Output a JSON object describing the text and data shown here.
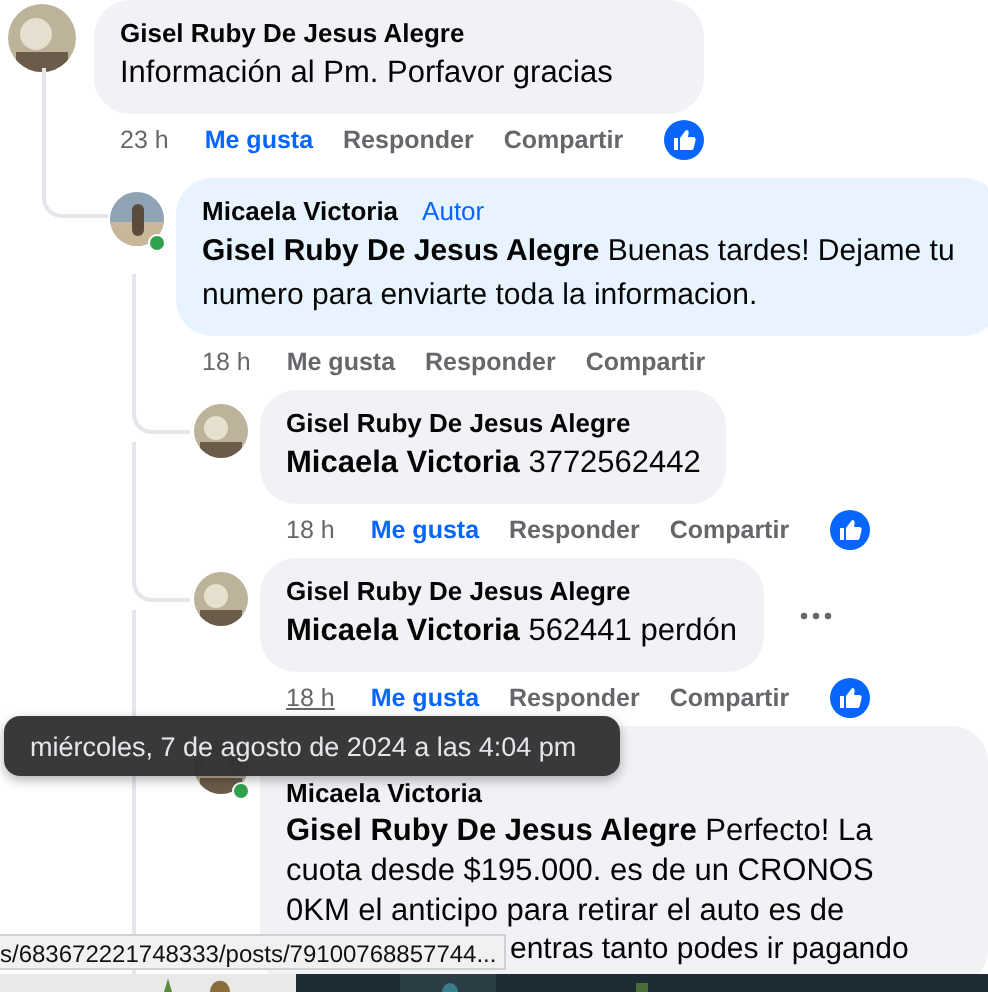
{
  "comments": [
    {
      "author": "Gisel Ruby De Jesus Alegre",
      "text": "Información al Pm. Porfavor gracias",
      "time": "23 h",
      "time_hovered": false,
      "liked": true,
      "reacted": true,
      "actions": [
        "Me gusta",
        "Responder",
        "Compartir"
      ],
      "children": [
        {
          "author": "Micaela Victoria",
          "badge": "Autor",
          "online": true,
          "text": "**Gisel Ruby De Jesus Alegre** Buenas tardes! Dejame tu numero para enviarte toda la informacion.",
          "time": "18 h",
          "time_hovered": false,
          "liked": false,
          "reacted": false,
          "actions": [
            "Me gusta",
            "Responder",
            "Compartir"
          ],
          "children": [
            {
              "author": "Gisel Ruby De Jesus Alegre",
              "online": false,
              "text": "**Micaela Victoria** 3772562442",
              "time": "18 h",
              "time_hovered": false,
              "liked": true,
              "reacted": true,
              "menu": false,
              "actions": [
                "Me gusta",
                "Responder",
                "Compartir"
              ]
            },
            {
              "author": "Gisel Ruby De Jesus Alegre",
              "online": false,
              "text": "**Micaela Victoria** 562441 perdón",
              "time": "18 h",
              "time_hovered": true,
              "liked": true,
              "reacted": true,
              "menu": true,
              "actions": [
                "Me gusta",
                "Responder",
                "Compartir"
              ]
            },
            {
              "author": "Micaela Victoria",
              "online": true,
              "menu": false,
              "text": "**Gisel Ruby De Jesus Alegre** Perfecto! La cuota desde $195.000. es de un CRONOS 0KM el anticipo para retirar el auto es de",
              "cut_line": "entras tanto podes ir pagando"
            }
          ]
        }
      ]
    }
  ],
  "tooltip": "miércoles, 7 de agosto de 2024 a las 4:04 pm",
  "status_bar": "s/683672221748333/posts/79100768857744..."
}
